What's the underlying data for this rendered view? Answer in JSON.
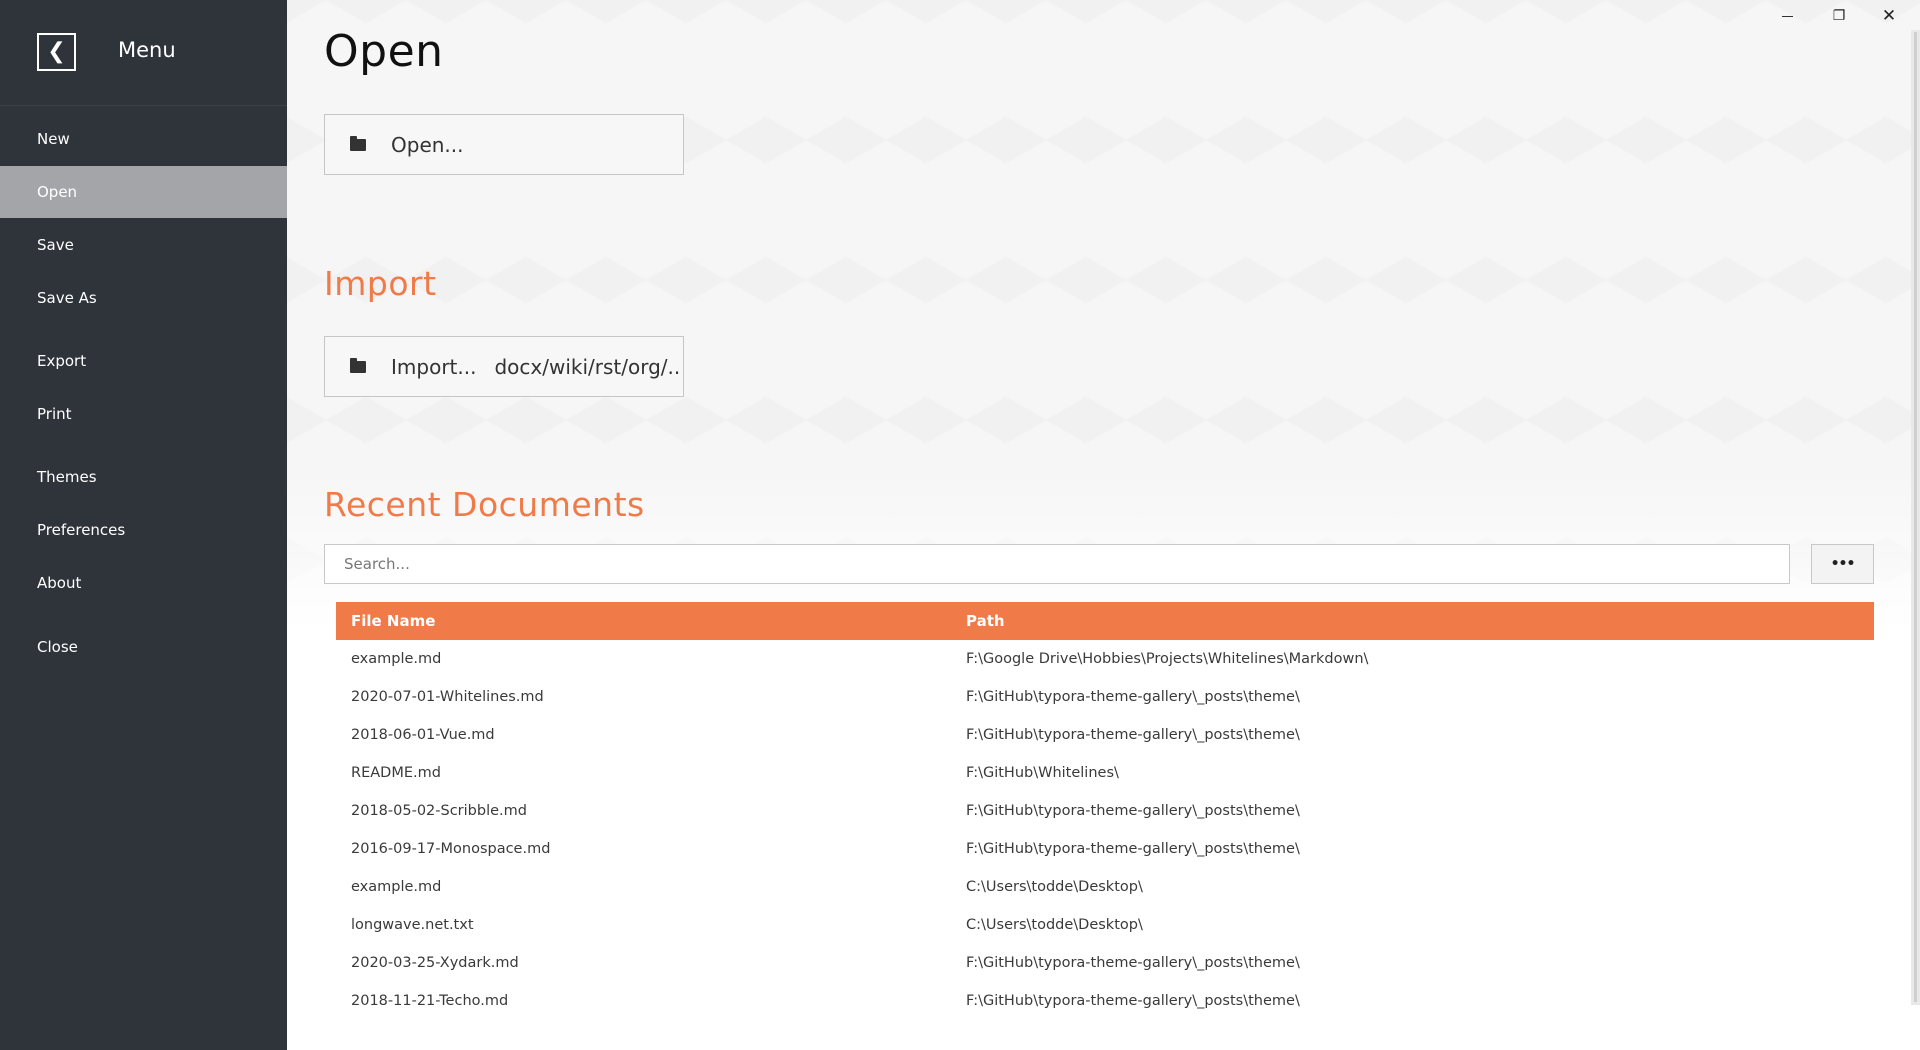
{
  "sidebar": {
    "title": "Menu",
    "back_glyph": "❮",
    "items": [
      {
        "label": "New",
        "active": false
      },
      {
        "label": "Open",
        "active": true
      },
      {
        "label": "Save",
        "active": false
      },
      {
        "label": "Save As",
        "active": false
      },
      {
        "label": "Export",
        "active": false
      },
      {
        "label": "Print",
        "active": false
      },
      {
        "label": "Themes",
        "active": false
      },
      {
        "label": "Preferences",
        "active": false
      },
      {
        "label": "About",
        "active": false
      },
      {
        "label": "Close",
        "active": false
      }
    ]
  },
  "window_controls": {
    "restore_glyph": "❐",
    "close_glyph": "✕"
  },
  "open": {
    "heading": "Open",
    "button_label": "Open..."
  },
  "import": {
    "heading": "Import",
    "button_label": "Import...",
    "formats": "docx/wiki/rst/org/.."
  },
  "recent": {
    "heading": "Recent Documents",
    "search_placeholder": "Search...",
    "more_glyph": "•••",
    "columns": [
      "File Name",
      "Path"
    ],
    "rows": [
      {
        "name": "example.md",
        "path": "F:\\Google Drive\\Hobbies\\Projects\\Whitelines\\Markdown\\"
      },
      {
        "name": "2020-07-01-Whitelines.md",
        "path": "F:\\GitHub\\typora-theme-gallery\\_posts\\theme\\"
      },
      {
        "name": "2018-06-01-Vue.md",
        "path": "F:\\GitHub\\typora-theme-gallery\\_posts\\theme\\"
      },
      {
        "name": "README.md",
        "path": "F:\\GitHub\\Whitelines\\"
      },
      {
        "name": "2018-05-02-Scribble.md",
        "path": "F:\\GitHub\\typora-theme-gallery\\_posts\\theme\\"
      },
      {
        "name": "2016-09-17-Monospace.md",
        "path": "F:\\GitHub\\typora-theme-gallery\\_posts\\theme\\"
      },
      {
        "name": "example.md",
        "path": "C:\\Users\\todde\\Desktop\\"
      },
      {
        "name": "longwave.net.txt",
        "path": "C:\\Users\\todde\\Desktop\\"
      },
      {
        "name": "2020-03-25-Xydark.md",
        "path": "F:\\GitHub\\typora-theme-gallery\\_posts\\theme\\"
      },
      {
        "name": "2018-11-21-Techo.md",
        "path": "F:\\GitHub\\typora-theme-gallery\\_posts\\theme\\"
      }
    ]
  },
  "colors": {
    "sidebar_bg": "#2f343b",
    "sidebar_active": "#a3a5a8",
    "accent": "#f07b48"
  },
  "icons": {
    "back": "back-arrow-icon",
    "folder": "folder-icon",
    "minimize": "minimize-icon",
    "restore": "restore-icon",
    "close": "close-icon",
    "more": "more-dots-icon"
  }
}
